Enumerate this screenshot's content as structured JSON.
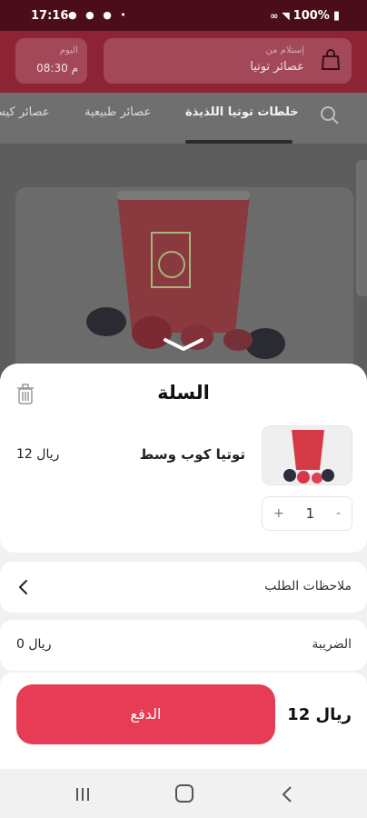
{
  "status_bar": {
    "time": "17:16",
    "battery": "100%"
  },
  "header": {
    "branch_caption": "إستلام من",
    "branch_name": "عصائر توتيا",
    "date_caption": "اليوم",
    "time": "08:30 م"
  },
  "tabs": [
    {
      "label": "خلطات توتيا اللذيذة",
      "active": true
    },
    {
      "label": "عصائر طبيعية",
      "active": false
    },
    {
      "label": "عصائر كيس",
      "active": false
    }
  ],
  "cart": {
    "title": "السلة",
    "item": {
      "name": "توتيا كوب وسط",
      "price": "12 ريال",
      "quantity": "1",
      "plus": "+",
      "minus": "-"
    },
    "notes_label": "ملاحظات الطلب",
    "tax_label": "الضريبة",
    "tax_value": "0 ريال",
    "pay_label": "الدفع",
    "total": "12 ريال"
  },
  "colors": {
    "header": "#8c2436",
    "accent": "#e63c55",
    "status_bar": "#4a0d19"
  }
}
